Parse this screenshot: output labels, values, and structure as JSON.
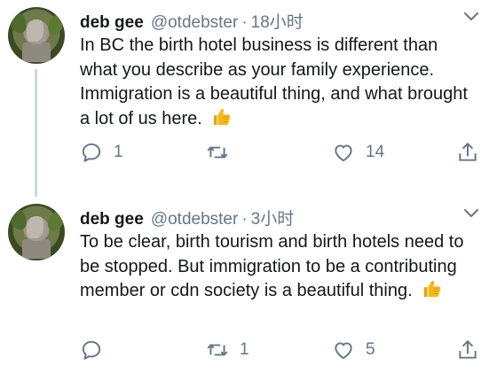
{
  "tweets": [
    {
      "display_name": "deb gee",
      "handle": "@otdebster",
      "separator": "·",
      "time": "18小时",
      "text": "In BC the birth hotel business is different than what you describe as your family experience. Immigration is a beautiful thing, and what brought a lot of us here.",
      "emoji": "thumbs-up",
      "actions": {
        "reply_count": "1",
        "retweet_count": "",
        "like_count": "14"
      }
    },
    {
      "display_name": "deb gee",
      "handle": "@otdebster",
      "separator": "·",
      "time": "3小时",
      "text": "To be clear, birth tourism and birth hotels need to be stopped.  But immigration to be a contributing member or cdn society is a beautiful thing.",
      "emoji": "thumbs-up",
      "actions": {
        "reply_count": "",
        "retweet_count": "1",
        "like_count": "5"
      }
    }
  ],
  "icons": {
    "reply": "reply-icon",
    "retweet": "retweet-icon",
    "like": "heart-icon",
    "share": "share-icon",
    "caret": "chevron-down-icon"
  },
  "colors": {
    "text": "#14171a",
    "secondary": "#657786",
    "thread_line": "#cdd9e3",
    "thumb": "#f5b81c"
  }
}
